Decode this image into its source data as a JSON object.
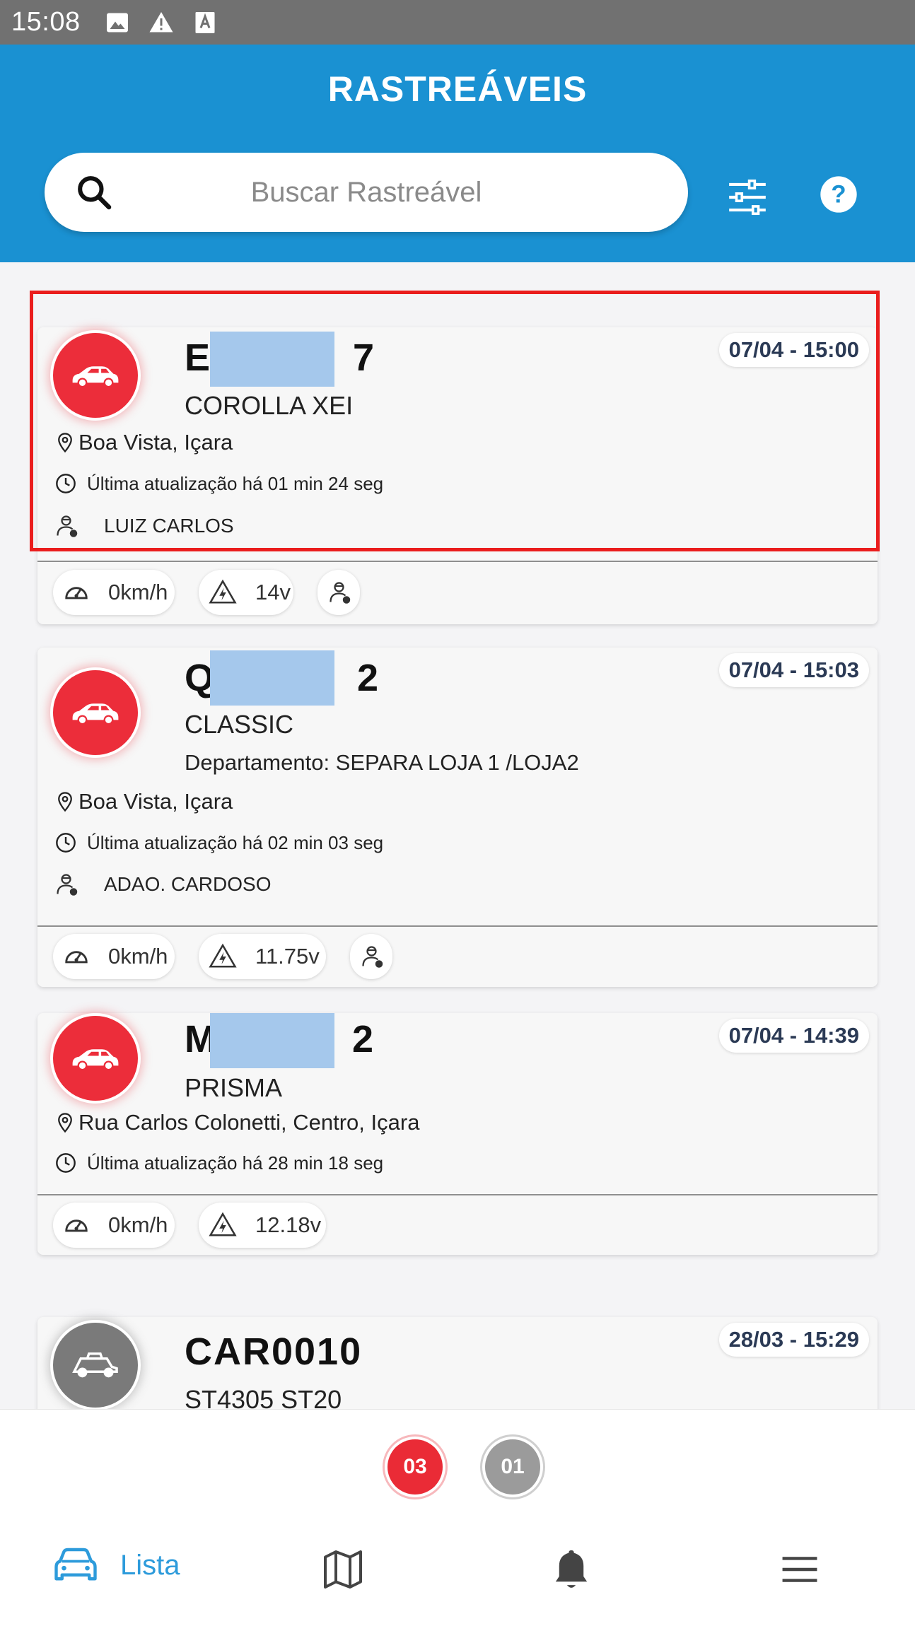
{
  "status_bar": {
    "time": "15:08",
    "icons": [
      "image-icon",
      "warning-icon",
      "font-icon"
    ]
  },
  "header": {
    "title": "RASTREÁVEIS",
    "search_placeholder": "Buscar Rastreável",
    "icons": [
      "search-icon",
      "filter-icon",
      "help-icon"
    ]
  },
  "colors": {
    "header": "#1a91d2",
    "accent_red": "#ec2d3a",
    "inactive_gray": "#7a7a7a",
    "nav_active": "#2d9bdb"
  },
  "vehicles": [
    {
      "plate_start": "E",
      "plate_end": "7",
      "model": "COROLLA XEI",
      "date": "07/04 - 15:00",
      "location": "Boa Vista, Içara",
      "updated": "Última atualização há 01 min 24 seg",
      "driver": "LUIZ CARLOS",
      "speed": "0km/h",
      "voltage": "14v",
      "status": "red",
      "icon": "car-icon"
    },
    {
      "plate_start": "Q",
      "plate_end": "2",
      "model": "CLASSIC",
      "department": "Departamento: SEPARA LOJA 1 /LOJA2",
      "date": "07/04 - 15:03",
      "location": "Boa Vista, Içara",
      "updated": "Última atualização há 02 min 03 seg",
      "driver": "ADAO. CARDOSO",
      "speed": "0km/h",
      "voltage": "11.75v",
      "status": "red",
      "icon": "car-icon"
    },
    {
      "plate_start": "M",
      "plate_end": "2",
      "model": "PRISMA",
      "date": "07/04 - 14:39",
      "location": "Rua Carlos Colonetti, Centro, Içara",
      "updated": "Última atualização há 28 min 18 seg",
      "speed": "0km/h",
      "voltage": "12.18v",
      "status": "red",
      "icon": "car-icon"
    },
    {
      "plate": "CAR0010",
      "model": "ST4305 ST20",
      "date": "28/03 - 15:29",
      "status": "gray",
      "icon": "buggy-icon"
    }
  ],
  "counters": {
    "red": "03",
    "gray": "01"
  },
  "bottom_nav": {
    "list_label": "Lista",
    "items": [
      "car-icon",
      "map-icon",
      "bell-icon",
      "menu-icon"
    ]
  }
}
